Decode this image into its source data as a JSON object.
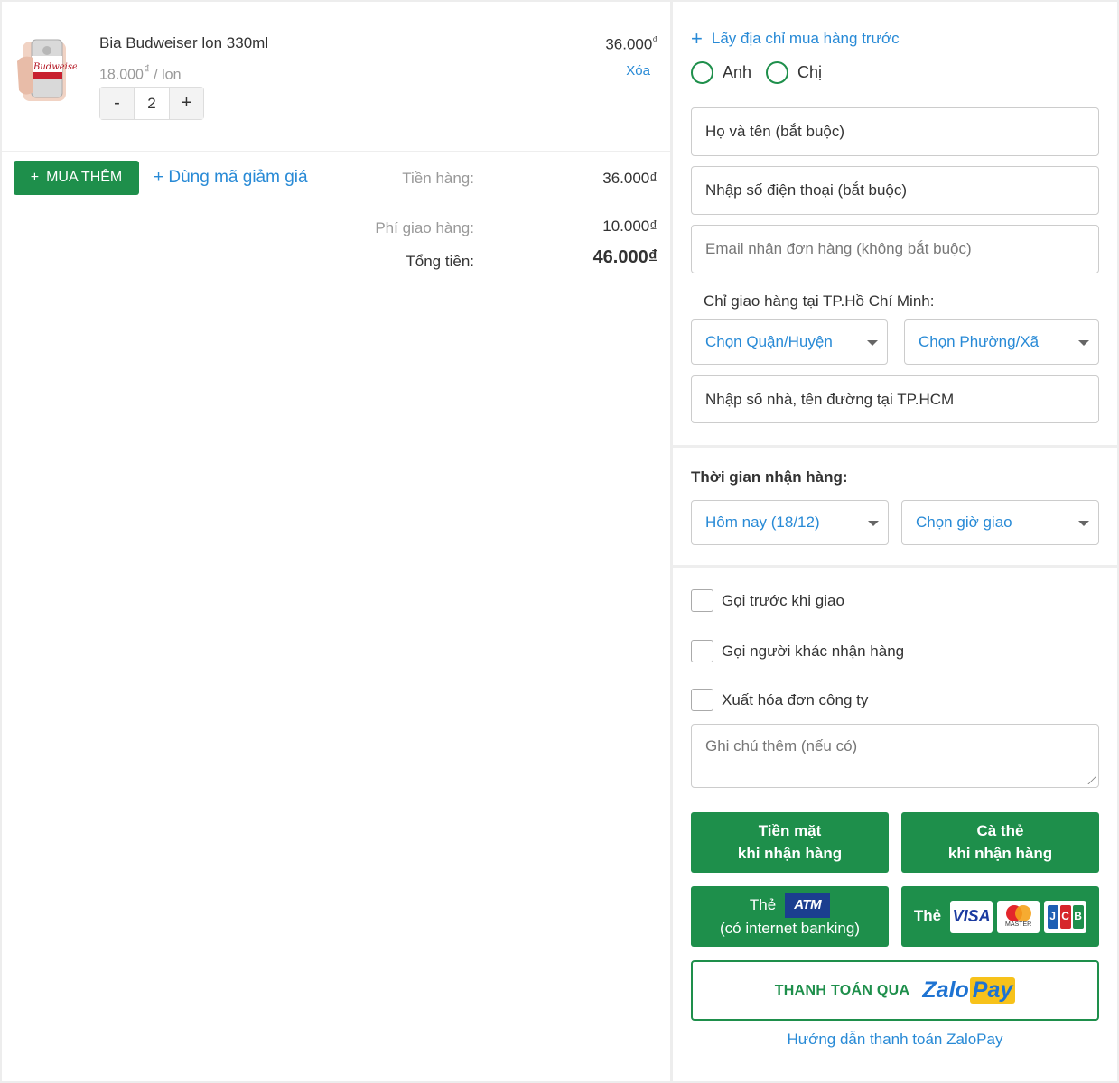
{
  "product": {
    "name": "Bia Budweiser lon 330ml",
    "unit_price": "18.000",
    "unit_price_currency": "₫",
    "unit": "/ lon",
    "price": "36.000",
    "price_currency": "₫",
    "delete_label": "Xóa",
    "quantity": "2",
    "minus_label": "-",
    "plus_label": "+",
    "image_label": "Budweiser"
  },
  "actions": {
    "buy_more_icon": "+",
    "buy_more_label": "MUA THÊM",
    "coupon_label": "+ Dùng mã giảm giá"
  },
  "summary": {
    "subtotal_label": "Tiền hàng:",
    "subtotal_value": "36.000₫",
    "shipping_label": "Phí giao hàng:",
    "shipping_value": "10.000₫",
    "total_label": "Tổng tiền:",
    "total_value": "46.000₫"
  },
  "customer": {
    "prev_address_icon": "+",
    "prev_address_label": "Lấy địa chỉ mua hàng trước",
    "gender_options": [
      "Anh",
      "Chị"
    ],
    "name_placeholder": "Họ và tên (bắt buộc)",
    "phone_placeholder": "Nhập số điện thoại (bắt buộc)",
    "email_placeholder": "Email nhận đơn hàng (không bắt buộc)",
    "delivery_note": "Chỉ giao hàng tại TP.Hồ Chí Minh:",
    "district_select": "Chọn Quận/Huyện",
    "ward_select": "Chọn Phường/Xã",
    "address_placeholder": "Nhập số nhà, tên đường tại TP.HCM"
  },
  "delivery_time": {
    "label": "Thời gian nhận hàng:",
    "day_select": "Hôm nay (18/12)",
    "hour_select": "Chọn giờ giao"
  },
  "options": {
    "call_before": "Gọi trước khi giao",
    "call_other": "Gọi người khác nhận hàng",
    "company_invoice": "Xuất hóa đơn công ty",
    "note_placeholder": "Ghi chú thêm (nếu có)"
  },
  "payment": {
    "cash_line1": "Tiền mặt",
    "cash_line2": "khi nhận hàng",
    "card_line1": "Cà thẻ",
    "card_line2": "khi nhận hàng",
    "atm_label": "Thẻ",
    "atm_badge": "ATM",
    "atm_sub": "(có internet banking)",
    "intl_label": "Thẻ",
    "visa": "VISA",
    "master": "MASTER",
    "jcb": [
      "J",
      "C",
      "B"
    ],
    "zalo_text": "THANH TOÁN QUA",
    "zalo_logo_a": "Zalo",
    "zalo_logo_b": "Pay",
    "zalo_guide": "Hướng dẫn thanh toán ZaloPay"
  },
  "colors": {
    "primary_green": "#1e8f4b",
    "link_blue": "#288ad6",
    "visa_blue": "#1a3aa0",
    "mastercard_red": "#e3262b",
    "mastercard_orange": "#f5a21b",
    "jcb_blue": "#1e5fb4",
    "jcb_red": "#d6262b",
    "jcb_green": "#1e8f4b",
    "zalo_blue": "#1e73d2",
    "zalo_yellow": "#f7c21a"
  }
}
